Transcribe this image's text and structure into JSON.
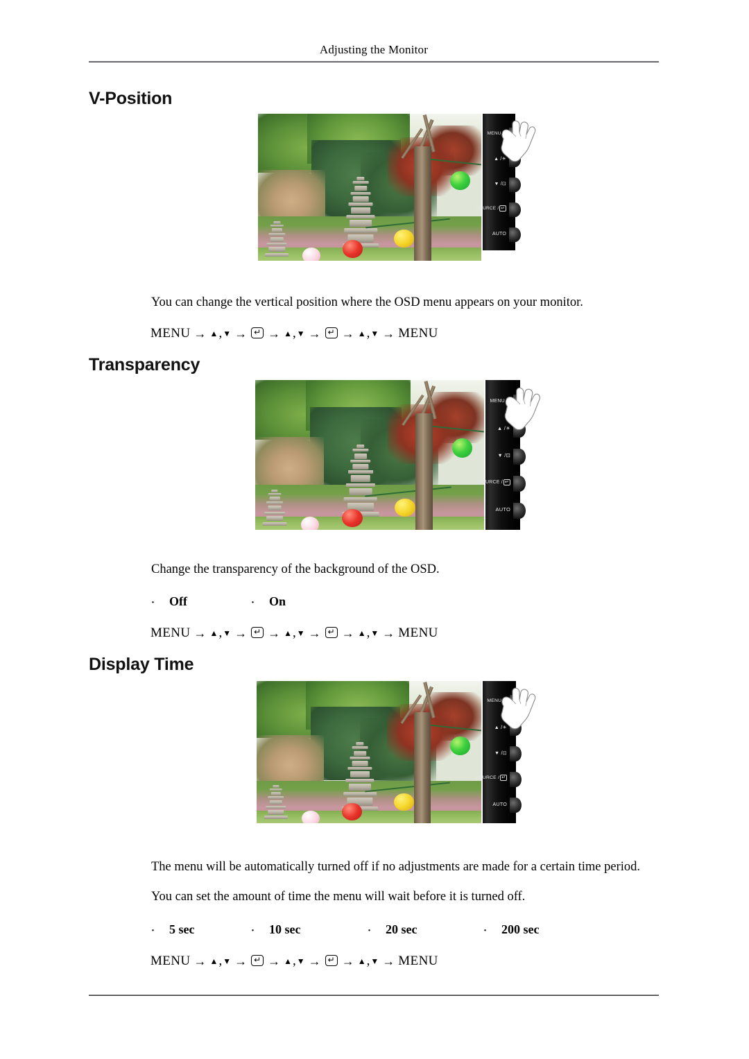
{
  "page": {
    "running_head": "Adjusting the Monitor"
  },
  "sections": [
    {
      "heading": "V-Position",
      "description": "You can change the vertical position where the OSD menu appears on your monitor.",
      "description2": "",
      "options": [],
      "nav_path": {
        "start": "MENU",
        "end": "MENU",
        "arrow": "→",
        "up": "▲",
        "down": "▼",
        "comma": ",",
        "enter": "↵"
      }
    },
    {
      "heading": "Transparency",
      "description": "Change the transparency of the background of the OSD.",
      "description2": "",
      "options": [
        "Off",
        "On"
      ],
      "nav_path": {
        "start": "MENU",
        "end": "MENU",
        "arrow": "→",
        "up": "▲",
        "down": "▼",
        "comma": ",",
        "enter": "↵"
      }
    },
    {
      "heading": "Display Time",
      "description": "The menu will be automatically turned off if no adjustments are made for a certain time period.",
      "description2": "You can set the amount of time the menu will wait before it is turned off.",
      "options": [
        "5 sec",
        "10 sec",
        "20 sec",
        "200 sec"
      ],
      "nav_path": {
        "start": "MENU",
        "end": "MENU",
        "arrow": "→",
        "up": "▲",
        "down": "▼",
        "comma": ",",
        "enter": "↵"
      }
    }
  ],
  "monitor": {
    "buttons": [
      {
        "label": "MENU /",
        "icon": "menu-bars-icon",
        "glyph": "‖‖"
      },
      {
        "label": "▲ /",
        "icon": "brightness-icon",
        "glyph": "☀"
      },
      {
        "label": "▼ /",
        "icon": "magicbright-icon",
        "glyph": "⊡"
      },
      {
        "label": "SOURCE /",
        "icon": "enter-icon",
        "glyph": "↵"
      },
      {
        "label": "AUTO",
        "icon": "auto-icon",
        "glyph": ""
      }
    ],
    "screen_content": "Korean temple garden with stone pagodas, paper lanterns and trees"
  },
  "bullet": "·"
}
